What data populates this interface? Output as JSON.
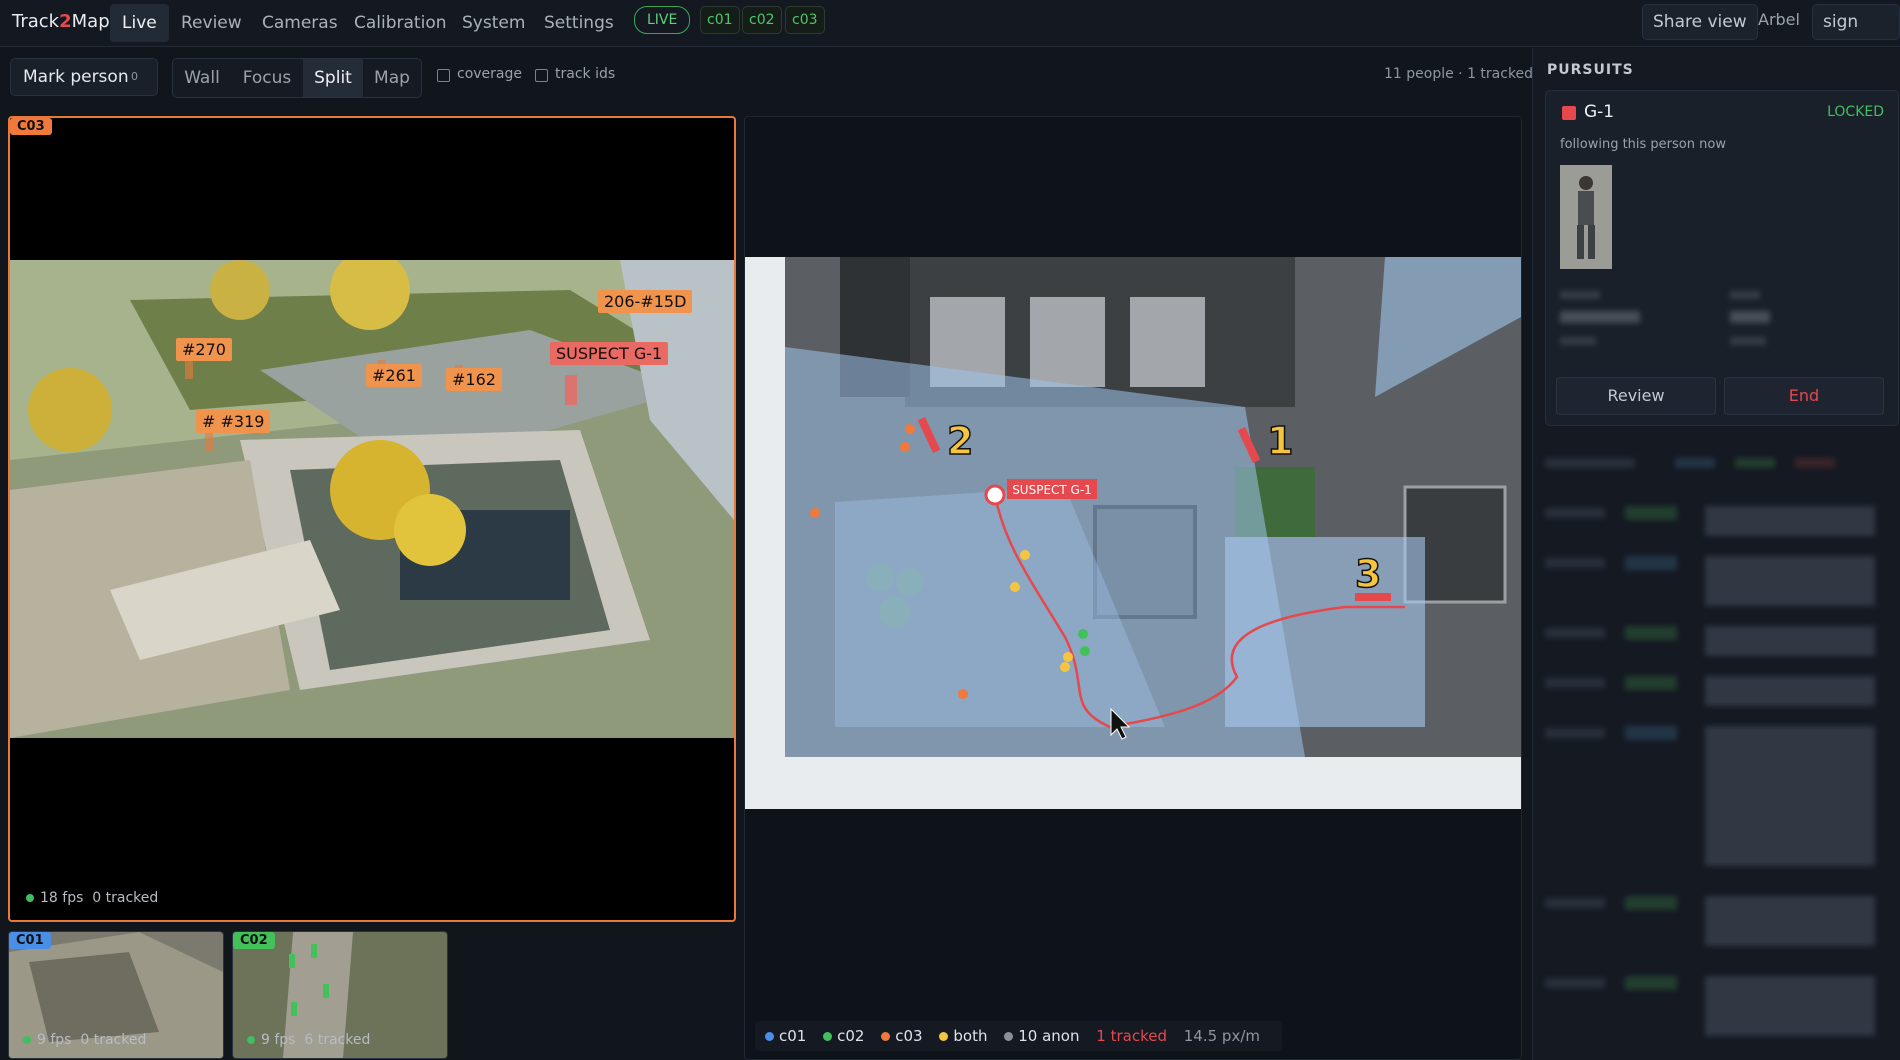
{
  "app": {
    "brand_a": "Track",
    "brand_b": "2",
    "brand_c": "Map"
  },
  "nav": [
    "Live",
    "Review",
    "Cameras",
    "Calibration",
    "System",
    "Settings"
  ],
  "status": {
    "live": "LIVE",
    "cams": [
      "c01",
      "c02",
      "c03"
    ]
  },
  "topright": {
    "share": "Share view",
    "user": "Arbel",
    "signout": "sign out"
  },
  "toolbar": {
    "mark": "Mark person",
    "mark_count": "0",
    "views": [
      "Wall",
      "Focus",
      "Split",
      "Map"
    ],
    "active_view": "Split",
    "coverage": "coverage",
    "trackids": "track ids",
    "summary": "11 people · 1 tracked"
  },
  "main_cam": {
    "tag": "C03",
    "fps": "18 fps",
    "tracked": "0 tracked",
    "labels": [
      "#270",
      "#261",
      "#162",
      "# #319",
      "206-#15D",
      "SUSPECT G-1"
    ]
  },
  "thumbs": [
    {
      "tag": "C01",
      "fps": "9 fps",
      "tracked": "0 tracked",
      "color": "#4a8fe7"
    },
    {
      "tag": "C02",
      "fps": "9 fps",
      "tracked": "6 tracked",
      "color": "#42c05a"
    }
  ],
  "map": {
    "suspect": "SUSPECT G-1",
    "cams": [
      "2",
      "1",
      "3"
    ],
    "legend": [
      {
        "label": "c01",
        "color": "#4a8fe7"
      },
      {
        "label": "c02",
        "color": "#42c05a"
      },
      {
        "label": "c03",
        "color": "#f0793b"
      },
      {
        "label": "both",
        "color": "#f5c542"
      },
      {
        "label": "10 anon",
        "color": "#8a9099"
      }
    ],
    "tracked": "1 tracked",
    "scale": "14.5 px/m"
  },
  "pursuits": {
    "title": "PURSUITS",
    "id": "G-1",
    "state": "LOCKED",
    "note": "following this person now",
    "review": "Review",
    "end": "End",
    "colors": {
      "accent": "#e5484d",
      "locked": "#3fbf5f"
    }
  }
}
